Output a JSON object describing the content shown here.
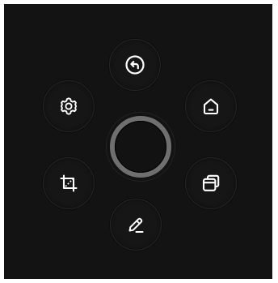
{
  "menu": {
    "center_button": {
      "icon": "circle-knob"
    },
    "items": [
      {
        "id": "back",
        "icon": "back-arrow-icon"
      },
      {
        "id": "home",
        "icon": "home-icon"
      },
      {
        "id": "recents",
        "icon": "recent-apps-icon"
      },
      {
        "id": "edit",
        "icon": "pencil-icon"
      },
      {
        "id": "crop",
        "icon": "crop-icon"
      },
      {
        "id": "settings",
        "icon": "gear-icon"
      }
    ]
  },
  "colors": {
    "panel_background": "#131313",
    "button_background": "#161616",
    "icon": "#ffffff",
    "center_ring": "#6f6f6f"
  }
}
